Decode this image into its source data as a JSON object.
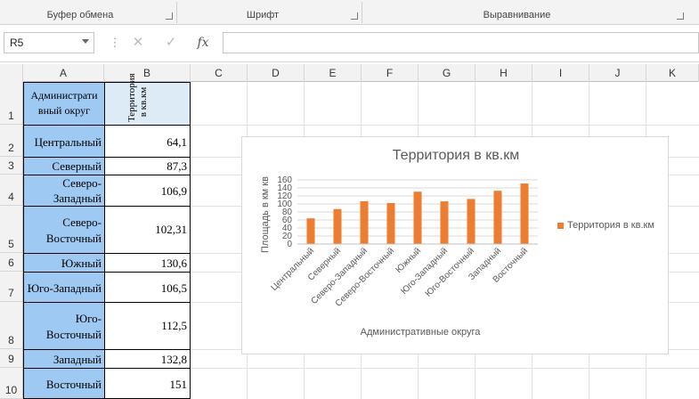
{
  "ribbon": {
    "groups": [
      "Буфер обмена",
      "Шрифт",
      "Выравнивание"
    ]
  },
  "formula_bar": {
    "name_box": "R5",
    "cancel_icon": "✕",
    "enter_icon": "✓",
    "fx_label": "fx",
    "formula": ""
  },
  "columns": [
    "A",
    "B",
    "C",
    "D",
    "E",
    "F",
    "G",
    "H",
    "I",
    "J",
    "K"
  ],
  "rows": [
    "1",
    "2",
    "3",
    "4",
    "5",
    "6",
    "7",
    "8",
    "9",
    "10"
  ],
  "table": {
    "header_a": "Администрати вный округ",
    "header_b": "Территория в кв.км",
    "districts": [
      {
        "name": "Центральный",
        "area": "64,1"
      },
      {
        "name": "Северный",
        "area": "87,3"
      },
      {
        "name": "Северо-Западный",
        "area": "106,9"
      },
      {
        "name": "Северо-Восточный",
        "area": "102,31"
      },
      {
        "name": "Южный",
        "area": "130,6"
      },
      {
        "name": "Юго-Западный",
        "area": "106,5"
      },
      {
        "name": "Юго-Восточный",
        "area": "112,5"
      },
      {
        "name": "Западный",
        "area": "132,8"
      },
      {
        "name": "Восточный",
        "area": "151"
      }
    ]
  },
  "chart_data": {
    "type": "bar",
    "title": "Территория в кв.км",
    "xlabel": "Административные округа",
    "ylabel": "Площадь в км  кв",
    "categories": [
      "Центральный",
      "Северный",
      "Северо-Западный",
      "Северо-Восточный",
      "Южный",
      "Юго-Западный",
      "Юго-Восточный",
      "Западный",
      "Восточный"
    ],
    "series": [
      {
        "name": "Территория в кв.км",
        "values": [
          64.1,
          87.3,
          106.9,
          102.31,
          130.6,
          106.5,
          112.5,
          132.8,
          151
        ]
      }
    ],
    "ylim": [
      0,
      160
    ],
    "yticks": [
      "0",
      "20",
      "40",
      "60",
      "80",
      "100",
      "120",
      "140",
      "160"
    ],
    "grid": true,
    "legend": "right",
    "bar_color": "#ed7d31"
  }
}
